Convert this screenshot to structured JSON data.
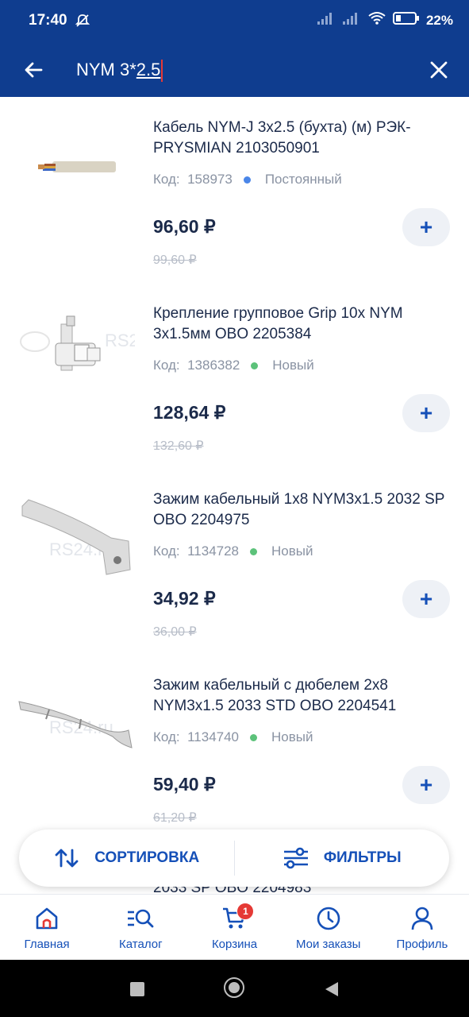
{
  "status": {
    "time": "17:40",
    "battery": "22%"
  },
  "search": {
    "value_plain": "NYM 3*",
    "value_highlight": "2.5"
  },
  "products": [
    {
      "title": "Кабель NYM-J 3х2.5 (бухта) (м) РЭК-PRYSMIAN 2103050901",
      "code_label": "Код:",
      "code": "158973",
      "status": "Постоянный",
      "status_color": "#4a86e8",
      "price": "96,60 ₽",
      "old_price": "99,60 ₽",
      "add": "+"
    },
    {
      "title": "Крепление групповое Grip 10x NYM 3x1.5мм OBO 2205384",
      "code_label": "Код:",
      "code": "1386382",
      "status": "Новый",
      "status_color": "#5cc27a",
      "price": "128,64 ₽",
      "old_price": "132,60 ₽",
      "add": "+"
    },
    {
      "title": "Зажим кабельный 1x8 NYM3x1.5 2032 SP OBO 2204975",
      "code_label": "Код:",
      "code": "1134728",
      "status": "Новый",
      "status_color": "#5cc27a",
      "price": "34,92 ₽",
      "old_price": "36,00 ₽",
      "add": "+"
    },
    {
      "title": "Зажим кабельный с дюбелем 2x8 NYM3x1.5 2033 STD OBO 2204541",
      "code_label": "Код:",
      "code": "1134740",
      "status": "Новый",
      "status_color": "#5cc27a",
      "price": "59,40 ₽",
      "old_price": "61,20 ₽",
      "add": "+"
    }
  ],
  "partial_item_title": "2033 SP OBO 2204983",
  "sortbar": {
    "sort_label": "СОРТИРОВКА",
    "filter_label": "ФИЛЬТРЫ"
  },
  "nav": [
    {
      "label": "Главная",
      "icon": "home-icon"
    },
    {
      "label": "Каталог",
      "icon": "catalog-search-icon"
    },
    {
      "label": "Корзина",
      "icon": "cart-icon",
      "badge": "1"
    },
    {
      "label": "Мои заказы",
      "icon": "clock-icon"
    },
    {
      "label": "Профиль",
      "icon": "user-icon"
    }
  ],
  "watermark": "RS24.ru",
  "colors": {
    "primary": "#0f3d8f",
    "accent": "#1550b8",
    "badge": "#e53935"
  }
}
